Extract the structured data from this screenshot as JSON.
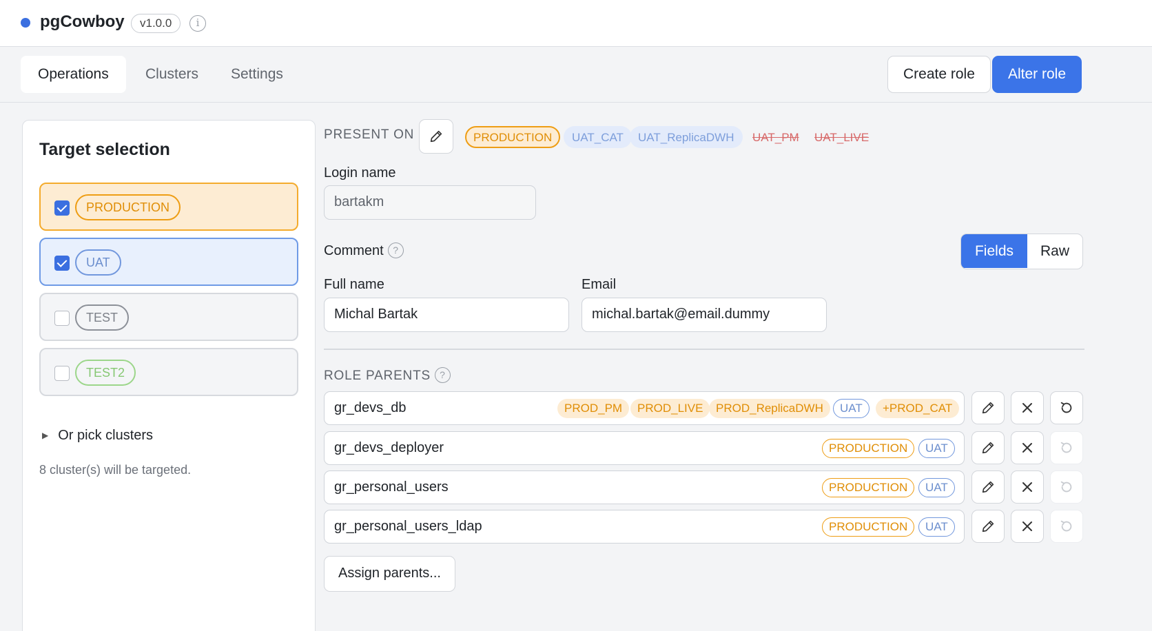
{
  "app": {
    "title": "pgCowboy",
    "version": "v1.0.0"
  },
  "tabs": [
    {
      "label": "Operations",
      "active": true
    },
    {
      "label": "Clusters",
      "active": false
    },
    {
      "label": "Settings",
      "active": false
    }
  ],
  "actions": {
    "create_role": "Create role",
    "alter_role": "Alter role"
  },
  "target_selection": {
    "title": "Target selection",
    "targets": [
      {
        "label": "PRODUCTION",
        "checked": true
      },
      {
        "label": "UAT",
        "checked": true
      },
      {
        "label": "TEST",
        "checked": false
      },
      {
        "label": "TEST2",
        "checked": false
      }
    ],
    "pick_clusters": "Or pick clusters",
    "count_text": "8 cluster(s) will be targeted."
  },
  "present_on": {
    "label": "PRESENT ON",
    "chips": [
      "PRODUCTION",
      "UAT_CAT",
      "UAT_ReplicaDWH",
      "UAT_PM",
      "UAT_LIVE"
    ]
  },
  "form": {
    "login_label": "Login name",
    "login_value": "bartakm",
    "comment_label": "Comment",
    "help_glyph": "?",
    "view_modes": {
      "fields": "Fields",
      "raw": "Raw"
    },
    "full_name_label": "Full name",
    "full_name_value": "Michal Bartak",
    "email_label": "Email",
    "email_value": "michal.bartak@email.dummy"
  },
  "role_parents": {
    "label": "ROLE PARENTS",
    "rows": [
      {
        "name": "gr_devs_db",
        "tags": [
          "PROD_PM",
          "PROD_LIVE",
          "PROD_ReplicaDWH",
          "UAT",
          "+PROD_CAT"
        ]
      },
      {
        "name": "gr_devs_deployer",
        "tags": [
          "PRODUCTION",
          "UAT"
        ]
      },
      {
        "name": "gr_personal_users",
        "tags": [
          "PRODUCTION",
          "UAT"
        ]
      },
      {
        "name": "gr_personal_users_ldap",
        "tags": [
          "PRODUCTION",
          "UAT"
        ]
      }
    ],
    "assign_button": "Assign parents..."
  },
  "colors": {
    "accent": "#3b74e8",
    "production": "#ee9d14",
    "uat": "#7197dd",
    "removed": "#d76969"
  }
}
